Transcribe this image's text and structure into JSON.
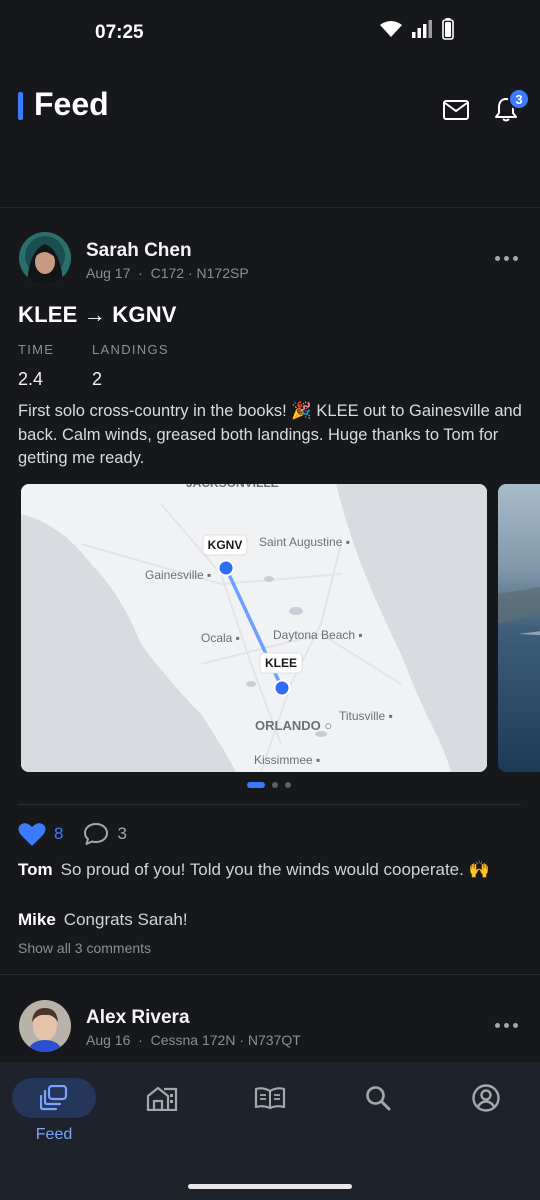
{
  "status_bar": {
    "time": "07:25"
  },
  "header": {
    "title": "Feed",
    "notification_count": "3",
    "mail_icon": "mail-icon",
    "bell_icon": "bell-icon"
  },
  "post": {
    "author": "Sarah Chen",
    "date": "Aug 17",
    "aircraft": "C172",
    "tail": "N172SP",
    "route": "KLEE → KGNV",
    "stats": [
      {
        "label": "TIME",
        "value": "2.4"
      },
      {
        "label": "LANDINGS",
        "value": "2"
      }
    ],
    "body": "First solo cross-country in the books! 🎉 KLEE out to Gainesville and back. Calm winds, greased both landings. Huge thanks to Tom for getting me ready.",
    "map": {
      "cities": [
        "JACKSONVILLE",
        "Saint Augustine",
        "Gainesville",
        "Ocala",
        "Daytona Beach",
        "ORLANDO",
        "Titusville",
        "Kissimmee"
      ],
      "origin_label": "KLEE",
      "destination_label": "KGNV",
      "route_color": "#6ea0ff",
      "marker_color": "#2f6df5"
    },
    "carousel_pages": 3,
    "carousel_active": 1,
    "likes": "8",
    "comments_count": "3",
    "comments": [
      {
        "author": "Tom",
        "text": "So proud of you! Told you the winds would cooperate. 🙌"
      },
      {
        "author": "Mike",
        "text": "Congrats Sarah!"
      }
    ],
    "show_all": "Show all 3 comments"
  },
  "next_post": {
    "author": "Alex Rivera",
    "date": "Aug 16",
    "aircraft": "Cessna 172N",
    "tail": "N737QT"
  },
  "nav": {
    "items": [
      {
        "name": "feed",
        "label": "Feed",
        "icon": "feed-icon",
        "active": true
      },
      {
        "name": "hangar",
        "label": "",
        "icon": "hangar-icon"
      },
      {
        "name": "logbook",
        "label": "",
        "icon": "logbook-icon"
      },
      {
        "name": "search",
        "label": "",
        "icon": "search-icon"
      },
      {
        "name": "profile",
        "label": "",
        "icon": "profile-icon"
      }
    ]
  },
  "colors": {
    "accent": "#3a7bff",
    "background": "#16181c"
  }
}
